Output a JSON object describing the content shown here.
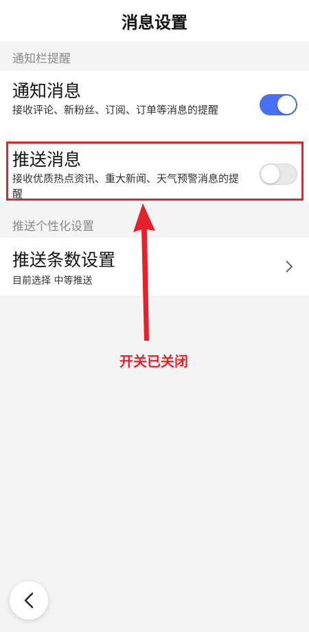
{
  "header": {
    "title": "消息设置"
  },
  "sections": {
    "notify_bar": {
      "label": "通知栏提醒"
    },
    "push_personal": {
      "label": "推送个性化设置"
    }
  },
  "rows": {
    "notify": {
      "title": "通知消息",
      "desc": "接收评论、新粉丝、订阅、订单等消息的提醒",
      "toggle_on": true
    },
    "push": {
      "title": "推送消息",
      "desc": "接收优质热点资讯、重大新闻、天气预警消息的提醒",
      "toggle_on": false
    },
    "push_count": {
      "title": "推送条数设置",
      "desc": "目前选择 中等推送"
    }
  },
  "annotation": {
    "text": "开关已关闭",
    "color": "#e8202a"
  },
  "icons": {
    "chevron": "chevron-right-icon",
    "back": "chevron-left-icon"
  },
  "colors": {
    "accent": "#4a6ff0"
  }
}
